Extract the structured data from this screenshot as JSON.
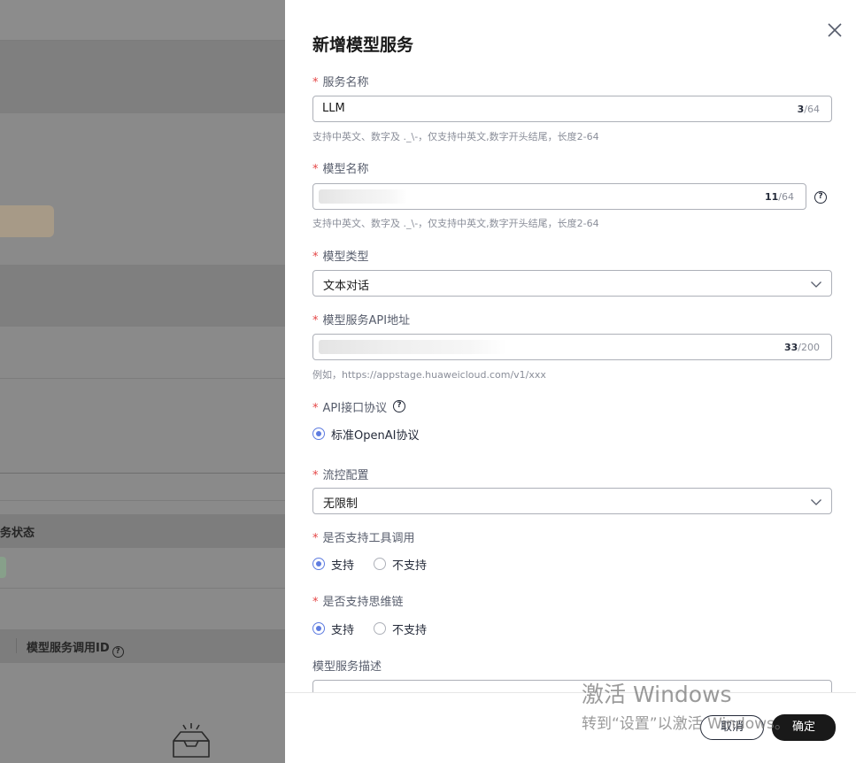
{
  "background": {
    "col_status": "务状态",
    "col_call_id": "模型服务调用ID"
  },
  "drawer": {
    "title": "新增模型服务",
    "fields": {
      "service_name": {
        "label": "服务名称",
        "value": "LLM",
        "count": "3",
        "max": "/64",
        "hint": "支持中英文、数字及 ._\\-，仅支持中英文,数字开头结尾，长度2-64"
      },
      "model_name": {
        "label": "模型名称",
        "count": "11",
        "max": "/64",
        "hint": "支持中英文、数字及 ._\\-，仅支持中英文,数字开头结尾，长度2-64"
      },
      "model_type": {
        "label": "模型类型",
        "value": "文本对话"
      },
      "api_url": {
        "label": "模型服务API地址",
        "count": "33",
        "max": "/200",
        "hint": "例如，https://appstage.huaweicloud.com/v1/xxx"
      },
      "protocol": {
        "label": "API接口协议",
        "options": [
          "标准OpenAI协议"
        ]
      },
      "rate_limit": {
        "label": "流控配置",
        "value": "无限制"
      },
      "tool_call": {
        "label": "是否支持工具调用",
        "options": [
          "支持",
          "不支持"
        ]
      },
      "chain_of_thought": {
        "label": "是否支持思维链",
        "options": [
          "支持",
          "不支持"
        ]
      },
      "description": {
        "label": "模型服务描述"
      }
    },
    "required_mark": "*",
    "help_glyph": "?",
    "footer": {
      "cancel_label": "取消",
      "ok_label": "确定"
    }
  },
  "watermark": {
    "line1": "激活 Windows",
    "line2": "转到“设置”以激活 Windows。"
  },
  "icons": {
    "close": "close-icon",
    "chevron": "chevron-down-icon",
    "help": "help-circle-icon",
    "empty": "empty-tray-icon"
  },
  "colors": {
    "primary_radio": "#5e7ce0",
    "required": "#e54545",
    "ok_button": "#191919"
  }
}
